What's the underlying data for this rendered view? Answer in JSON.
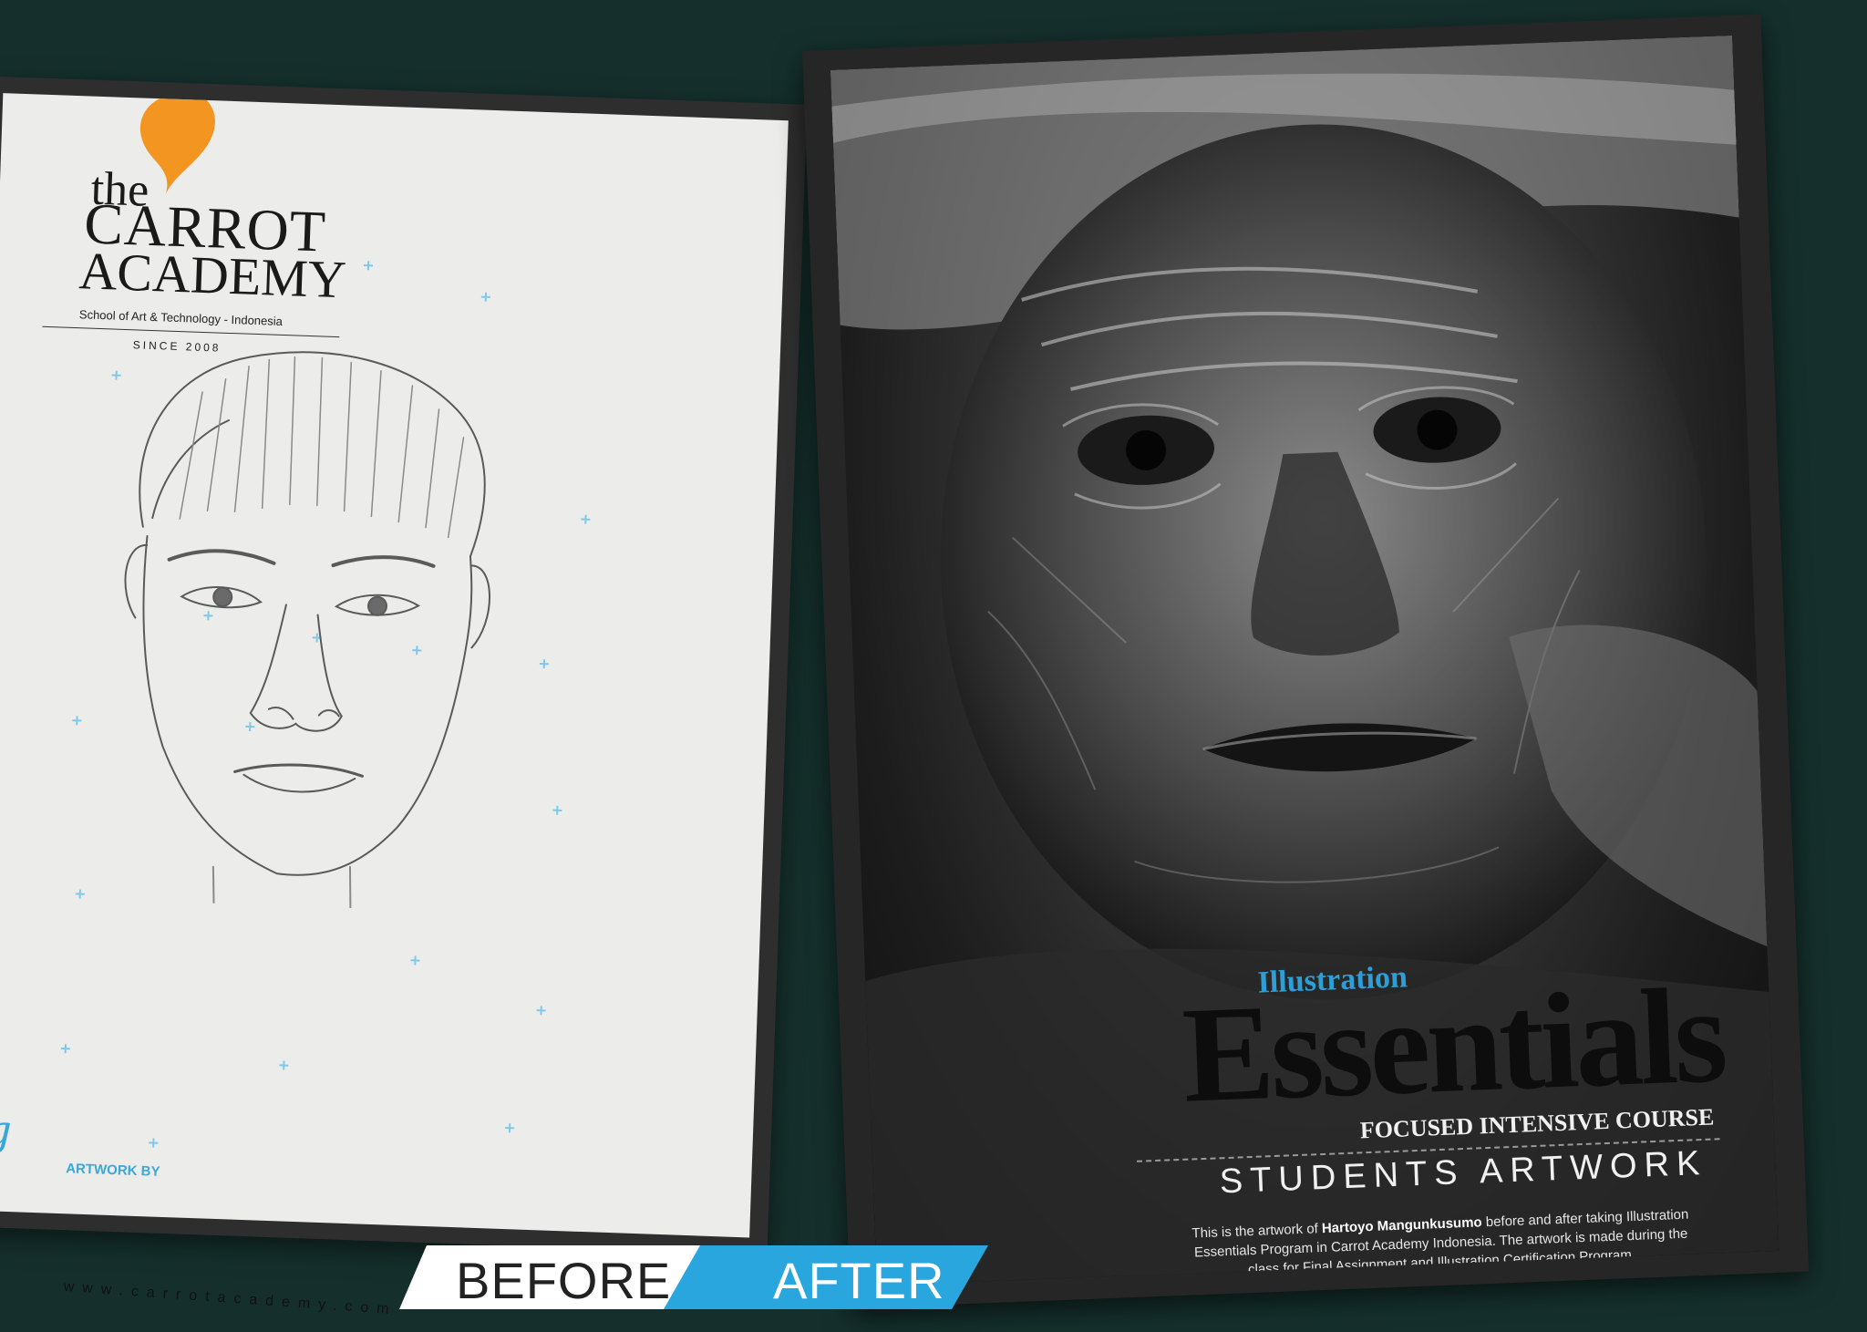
{
  "left_page": {
    "logo": {
      "line1": "the",
      "line2": "CARROT",
      "line3": "ACADEMY",
      "tagline": "School of Art & Technology - Indonesia",
      "since": "SINCE 2008"
    },
    "artwork_by": "ARTWORK BY",
    "partial_logo_text": "ng",
    "website": "www.carrotacademy.com"
  },
  "right_page": {
    "illustration": "Illustration",
    "essentials": "Essentials",
    "focused": "FOCUSED INTENSIVE COURSE",
    "students": "STUDENTS ARTWORK",
    "desc_pre": "This is the artwork of ",
    "artist": "Hartoyo Mangunkusumo",
    "desc_post": " before and after taking Illustration Essentials Program in Carrot Academy Indonesia. The artwork is made during the class for Final Assignment and Illustration Certification Program."
  },
  "banner": {
    "before": "BEFORE",
    "after": "AFTER"
  },
  "colors": {
    "background": "#15302c",
    "accent_blue": "#2aa6de",
    "logo_orange": "#f39521"
  }
}
